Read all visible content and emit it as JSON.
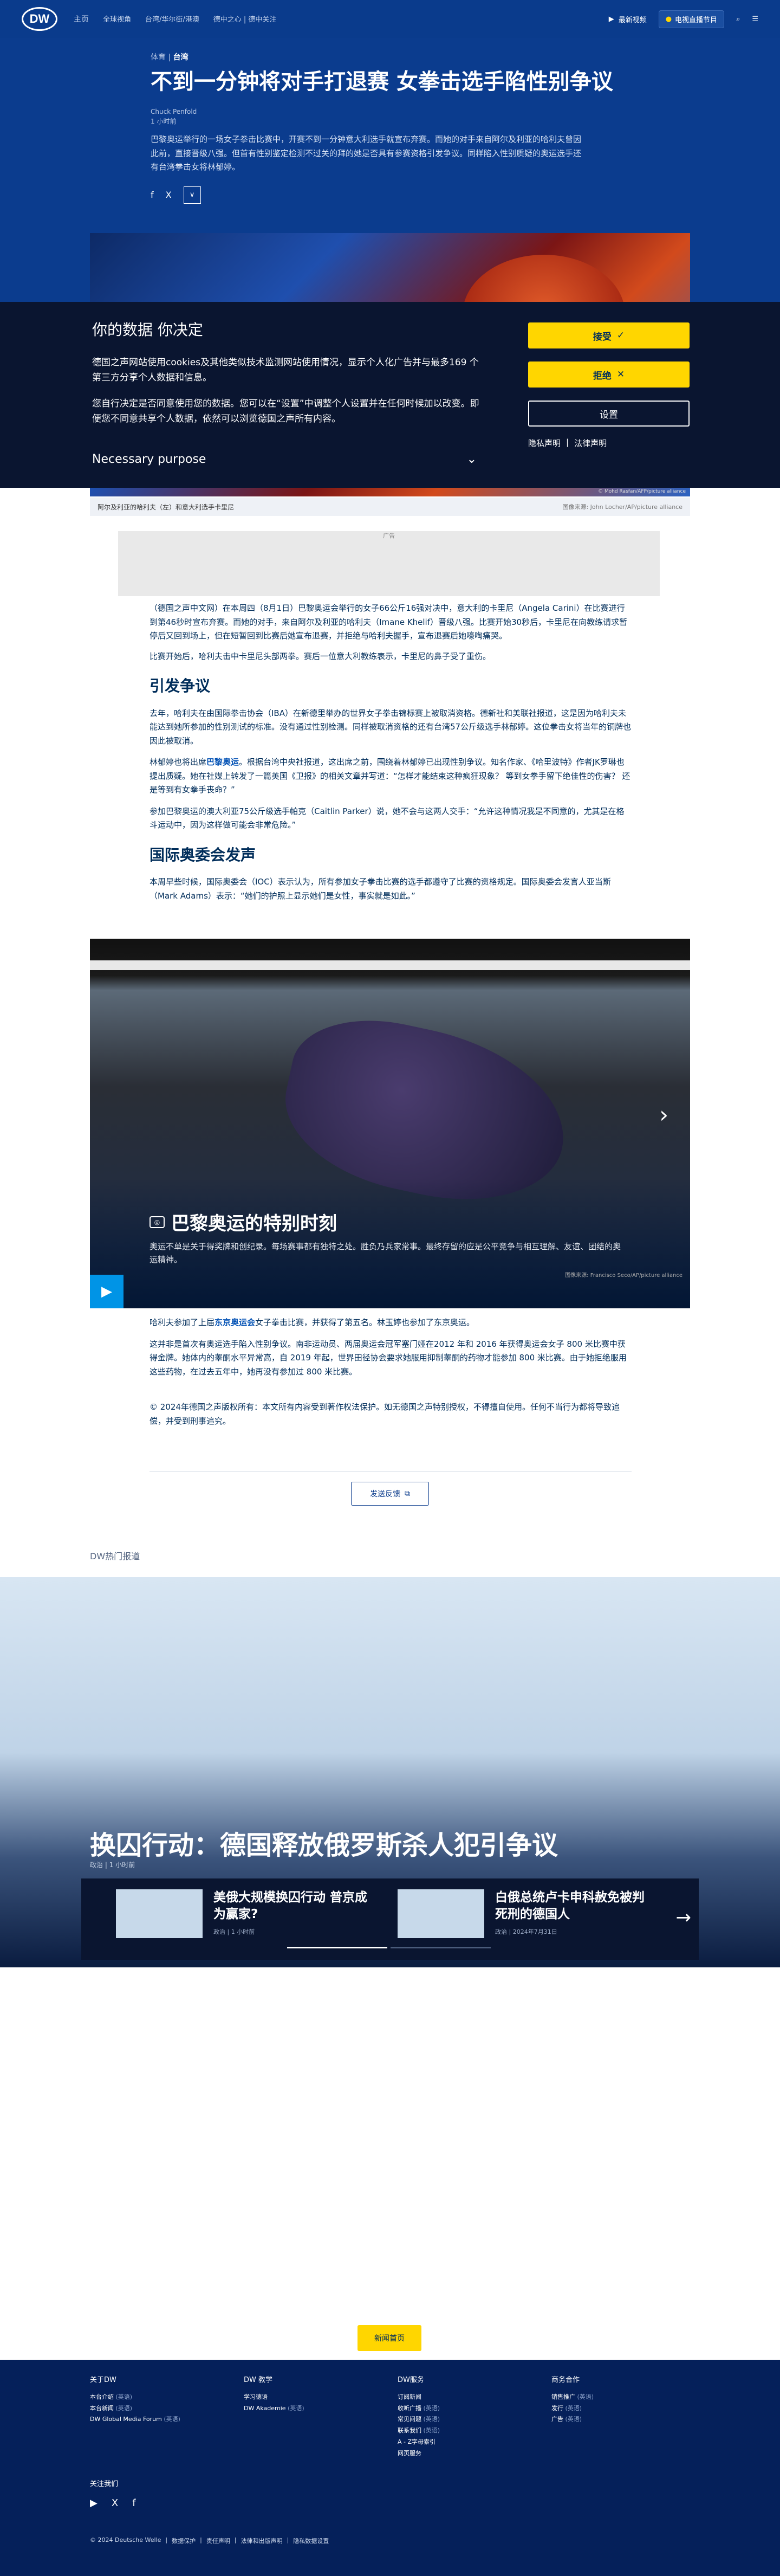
{
  "header": {
    "logo": "DW",
    "nav": [
      "主页",
      "全球视角",
      "台湾/华尔街/港澳",
      "德中之心 | 德中关注"
    ],
    "latest": "最新视频",
    "tv": "电视直播节目"
  },
  "hero": {
    "breadcrumb_section": "体育",
    "breadcrumb_sep": "|",
    "breadcrumb_region": "台湾",
    "title": "不到一分钟将对手打退赛 女拳击选手陷性别争议",
    "author": "Chuck Penfold",
    "time": "1 小时前",
    "lead": "巴黎奥运举行的一场女子拳击比赛中，开赛不到一分钟意大利选手就宣布弃赛。而她的对手来自阿尔及利亚的哈利夫曾因此前，直接晋级八强。但首有性别鉴定检测不过关的拜的她是否具有参赛资格引发争议。同样陷入性别质疑的奥运选手还有台湾拳击女将林郁婷。",
    "share": [
      "f",
      "X"
    ],
    "share_more": "∨"
  },
  "hero_image": {
    "credit": "© Mohd Rasfan/AFP/picture alliance",
    "caption": "阿尔及利亚的哈利夫（左）和意大利选手卡里尼",
    "caption_credit": "图像来源: John Locher/AP/picture alliance"
  },
  "cookie": {
    "title": "你的数据 你决定",
    "p1": "德国之声网站使用cookies及其他类似技术监测网站使用情况，显示个人化广告并与最多169 个第三方分享个人数据和信息。",
    "p2": "您自行决定是否同意使用您的数据。您可以在“设置”中调整个人设置并在任何时候加以改变。即便您不同意共享个人数据，依然可以浏览德国之声所有内容。",
    "purpose": "Necessary purpose",
    "purpose_icon": "⌄",
    "accept": "接受",
    "accept_icon": "✓",
    "reject": "拒绝",
    "reject_icon": "✕",
    "settings": "设置",
    "privacy": "隐私声明",
    "link_sep": "|",
    "legal": "法律声明"
  },
  "ad": {
    "label": "广告"
  },
  "article": {
    "p1": "（德国之声中文网）在本周四（8月1日）巴黎奥运会举行的女子66公斤16强对决中，意大利的卡里尼（Angela Carini）在比赛进行到第46秒时宣布弃赛。而她的对手，来自阿尔及利亚的哈利夫（Imane Khelif）晋级八强。比赛开始30秒后，卡里尼在向教练请求暂停后又回到场上，但在短暂回到比赛后她宣布退赛，并拒绝与哈利夫握手，宣布退赛后她嚎啕痛哭。",
    "p2": "比赛开始后，哈利夫击中卡里尼头部两拳。赛后一位意大利教练表示，卡里尼的鼻子受了重伤。",
    "h1": "引发争议",
    "p3": "去年，哈利夫在由国际拳击协会（IBA）在新德里举办的世界女子拳击锦标赛上被取消资格。德新社和美联社报道，这是因为哈利夫未能达到她所参加的性别测试的标准。没有通过性别检测。同样被取消资格的还有台湾57公斤级选手林郁婷。这位拳击女将当年的铜牌也因此被取消。",
    "p4a": "林郁婷也将出席",
    "p4link": "巴黎奥运",
    "p4b": "。根据台湾中央社报道，这出席之前，围绕着林郁婷已出现性别争议。知名作家、《哈里波特》作者JK罗琳也提出质疑。她在社媒上转发了一篇英国《卫报》的相关文章并写道：“怎样才能结束这种疯狂现象？ 等到女拳手留下绝佳性的伤害？ 还是等到有女拳手丧命？”",
    "p5": "参加巴黎奥运的澳大利亚75公斤级选手帕克（Caitlin Parker）说，她不会与这两人交手：“允许这种情况我是不同意的，尤其是在格斗运动中，因为这样做可能会非常危险。”",
    "h2": "国际奥委会发声",
    "p6": "本周早些时候，国际奥委会（IOC）表示认为，所有参加女子拳击比赛的选手都遵守了比赛的资格规定。国际奥委会发言人亚当斯（Mark Adams）表示：“她们的护照上显示她们是女性，事实就是如此。”",
    "p7a": "哈利夫参加了上届",
    "p7link": "东京奥运会",
    "p7b": "女子拳击比赛，并获得了第五名。林玉婷也参加了东京奥运。",
    "p8": "这并非是首次有奥运选手陷入性别争议。南非运动员、两届奥运会冠军塞门娅在2012 年和 2016 年获得奥运会女子 800 米比赛中获得金牌。她体内的睾酮水平异常高，自 2019 年起，世界田径协会要求她服用抑制睾酮的药物才能参加 800 米比赛。由于她拒绝服用这些药物，在过去五年中，她再没有参加过 800 米比赛。",
    "copyright": "© 2024年德国之声版权所有：本文所有内容受到著作权法保护。如无德国之声特别授权，不得擅自使用。任何不当行为都将导致追偿，并受到刑事追究。"
  },
  "slideshow": {
    "title": "巴黎奥运的特别时刻",
    "desc": "奥运不单是关于得奖牌和创纪录。每场赛事都有独特之处。胜负乃兵家常事。最终存留的应是公平竞争与相互理解、友谊、团结的奥运精神。",
    "credit": "图像来源: Francisco Seco/AP/picture alliance",
    "next": "›",
    "play": "▶",
    "camera_icon": "◎"
  },
  "feedback": {
    "label": "发送反馈",
    "icon": "⧉"
  },
  "hot": {
    "label": "DW热门报道",
    "feature_title": "换囚行动：德国释放俄罗斯杀人犯引争议",
    "feature_meta_section": "政治",
    "feature_meta_time": "1 小时前",
    "teaser1_title": "美俄大规模换囚行动 普京成为赢家?",
    "teaser1_section": "政治",
    "teaser1_time": "1 小时前",
    "teaser2_title": "白俄总统卢卡申科赦免被判死刑的德国人",
    "teaser2_section": "政治",
    "teaser2_time": "2024年7月31日",
    "arrow": "→",
    "more": "新闻首页"
  },
  "footer": {
    "col1_title": "关于DW",
    "col1_items": [
      {
        "label": "本台介绍",
        "sub": "(英语)"
      },
      {
        "label": "本台新闻",
        "sub": "(英语)"
      },
      {
        "label": "DW Global Media Forum",
        "sub": "(英语)"
      }
    ],
    "col2_title": "DW 教学",
    "col2_items": [
      {
        "label": "学习德语",
        "sub": ""
      },
      {
        "label": "DW Akademie",
        "sub": "(英语)"
      }
    ],
    "col3_title": "DW服务",
    "col3_items": [
      {
        "label": "订阅新闻",
        "sub": ""
      },
      {
        "label": "收听广播",
        "sub": "(英语)"
      },
      {
        "label": "常见问题",
        "sub": "(英语)"
      },
      {
        "label": "联系我们",
        "sub": "(英语)"
      },
      {
        "label": "A - Z字母索引",
        "sub": ""
      },
      {
        "label": "网页服务",
        "sub": ""
      }
    ],
    "col4_title": "商务合作",
    "col4_items": [
      {
        "label": "销售推广",
        "sub": "(英语)"
      },
      {
        "label": "发行",
        "sub": "(英语)"
      },
      {
        "label": "广告",
        "sub": "(英语)"
      }
    ],
    "follow": "关注我们",
    "social": [
      "▶",
      "X",
      "f"
    ],
    "legal": [
      "© 2024 Deutsche Welle",
      "数据保护",
      "责任声明",
      "法律和出版声明",
      "隐私数据设置"
    ],
    "legal_sep": "|"
  }
}
